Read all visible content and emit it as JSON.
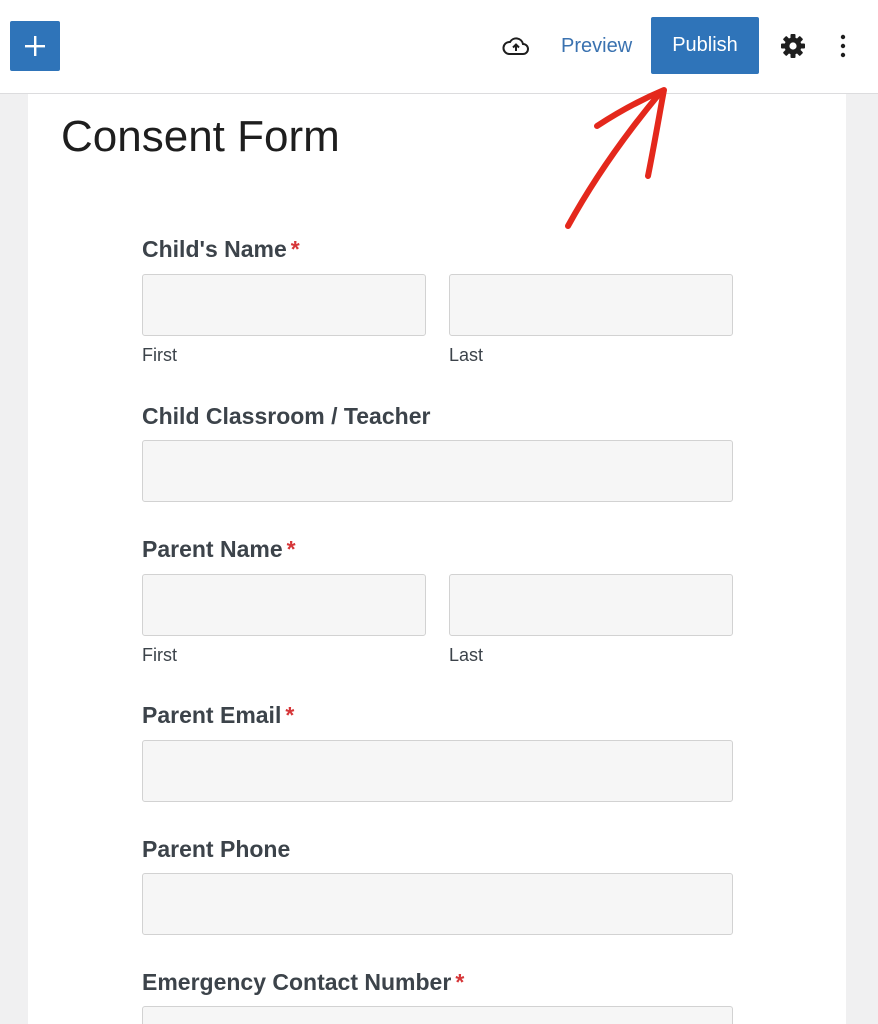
{
  "toolbar": {
    "add_icon": "plus-icon",
    "save_icon": "cloud-upload-icon",
    "preview_label": "Preview",
    "publish_label": "Publish",
    "settings_icon": "gear-icon",
    "more_icon": "vertical-ellipsis-icon",
    "accent_color": "#2f74b9"
  },
  "annotation": {
    "type": "hand-drawn-arrow",
    "color": "#e4281c",
    "points_to": "Publish"
  },
  "page": {
    "title": "Consent Form"
  },
  "form": {
    "required_marker": "*",
    "fields": [
      {
        "label": "Child's Name",
        "required": true,
        "sub": {
          "first": "First",
          "last": "Last"
        }
      },
      {
        "label": "Child Classroom / Teacher",
        "required": false
      },
      {
        "label": "Parent Name",
        "required": true,
        "sub": {
          "first": "First",
          "last": "Last"
        }
      },
      {
        "label": "Parent Email",
        "required": true
      },
      {
        "label": "Parent Phone",
        "required": false
      },
      {
        "label": "Emergency Contact Number",
        "required": true
      }
    ]
  }
}
